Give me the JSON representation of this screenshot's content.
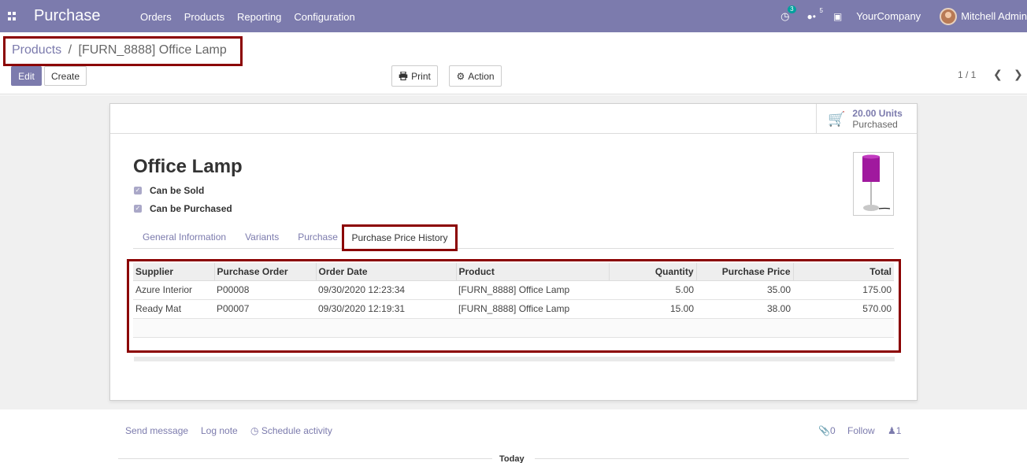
{
  "navbar": {
    "brand": "Purchase",
    "menu": [
      "Orders",
      "Products",
      "Reporting",
      "Configuration"
    ],
    "activity_count": "3",
    "message_count": "5",
    "company": "YourCompany",
    "user": "Mitchell Admin"
  },
  "breadcrumb": {
    "parent": "Products",
    "separator": "/",
    "current": "[FURN_8888] Office Lamp"
  },
  "toolbar": {
    "edit_label": "Edit",
    "create_label": "Create",
    "print_label": "Print",
    "action_label": "Action",
    "pager": "1 / 1"
  },
  "stat_button": {
    "value": "20.00 Units",
    "label": "Purchased"
  },
  "product": {
    "name": "Office Lamp",
    "can_be_sold_label": "Can be Sold",
    "can_be_purchased_label": "Can be Purchased"
  },
  "tabs": [
    "General Information",
    "Variants",
    "Purchase",
    "Purchase Price History"
  ],
  "table": {
    "columns": [
      "Supplier",
      "Purchase Order",
      "Order Date",
      "Product",
      "Quantity",
      "Purchase Price",
      "Total"
    ],
    "rows": [
      [
        "Azure Interior",
        "P00008",
        "09/30/2020 12:23:34",
        "[FURN_8888] Office Lamp",
        "5.00",
        "35.00",
        "175.00"
      ],
      [
        "Ready Mat",
        "P00007",
        "09/30/2020 12:19:31",
        "[FURN_8888] Office Lamp",
        "15.00",
        "38.00",
        "570.00"
      ]
    ]
  },
  "chatter": {
    "send_message": "Send message",
    "log_note": "Log note",
    "schedule_activity": "Schedule activity",
    "attachments": "0",
    "follow": "Follow",
    "followers": "1",
    "today": "Today"
  },
  "colors": {
    "brand": "#7c7bad",
    "highlight": "#8b0000"
  }
}
